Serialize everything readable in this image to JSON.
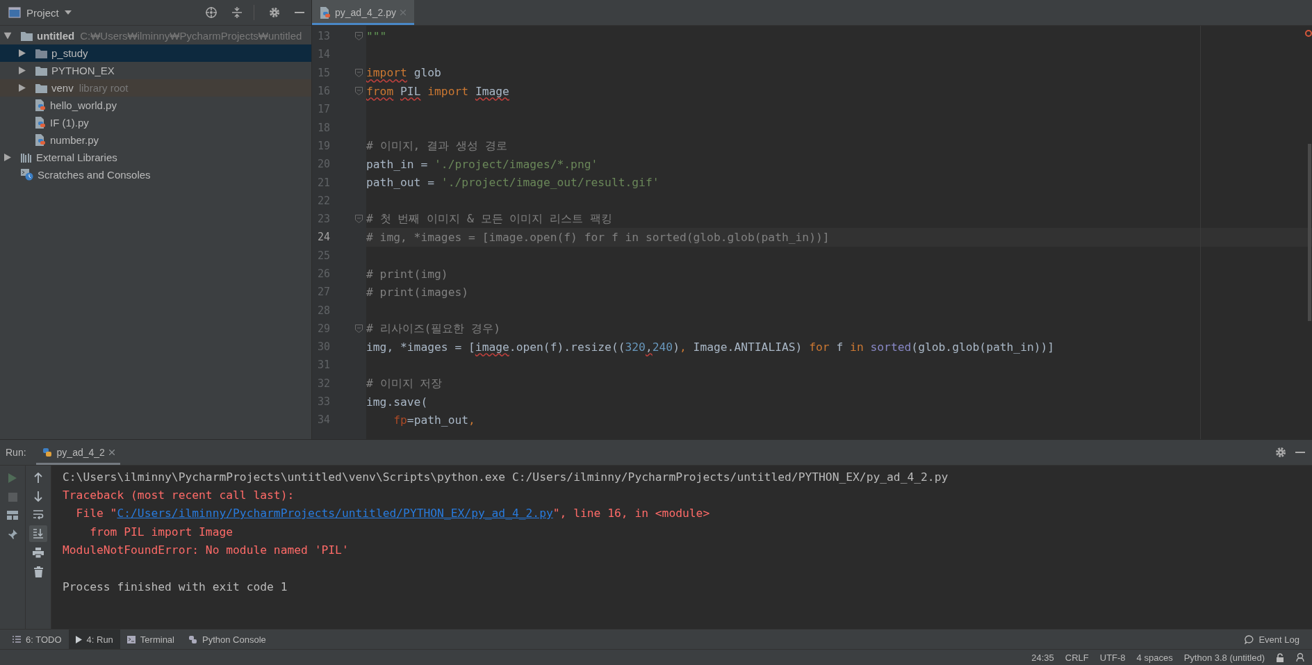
{
  "project_panel": {
    "title": "Project",
    "tree": [
      {
        "label": "untitled",
        "hint": "C:₩Users₩ilminny₩PycharmProjects₩untitled",
        "kind": "project-folder",
        "expanded": true,
        "selected": false,
        "children": [
          {
            "label": "p_study",
            "kind": "folder",
            "expanded": false,
            "selected": true
          },
          {
            "label": "PYTHON_EX",
            "kind": "folder",
            "expanded": false,
            "selected": false
          },
          {
            "label": "venv",
            "hint": "library root",
            "kind": "library-folder",
            "expanded": false,
            "selected": false
          },
          {
            "label": "hello_world.py",
            "kind": "python-file",
            "selected": false
          },
          {
            "label": "IF (1).py",
            "kind": "python-file",
            "selected": false
          },
          {
            "label": "number.py",
            "kind": "python-file",
            "selected": false
          }
        ]
      },
      {
        "label": "External Libraries",
        "kind": "libraries",
        "expanded": false,
        "selected": false
      },
      {
        "label": "Scratches and Consoles",
        "kind": "scratches",
        "selected": false
      }
    ]
  },
  "editor": {
    "tabs": [
      {
        "label": "py_ad_4_2.py",
        "selected": true
      }
    ],
    "lines": [
      {
        "n": "13",
        "fold": true,
        "current": false,
        "tokens": [
          {
            "text": "\"\"\"",
            "kind": "docstring"
          }
        ]
      },
      {
        "n": "14",
        "fold": false,
        "current": false
      },
      {
        "n": "15",
        "fold": true,
        "current": false,
        "tokens": [
          {
            "text": "import",
            "kind": "kw-warn"
          },
          {
            "text": " glob",
            "kind": "plain"
          }
        ]
      },
      {
        "n": "16",
        "fold": true,
        "current": false,
        "tokens": [
          {
            "text": "from ",
            "kind": "kw-warn"
          },
          {
            "text": "PIL ",
            "kind": "plain-warn"
          },
          {
            "text": "import ",
            "kind": "kw"
          },
          {
            "text": "Image",
            "kind": "plain-warn"
          }
        ]
      },
      {
        "n": "17",
        "fold": false,
        "current": false
      },
      {
        "n": "18",
        "fold": false,
        "current": false
      },
      {
        "n": "19",
        "fold": false,
        "current": false,
        "tokens": [
          {
            "text": "# 이미지, 결과 생성 경로",
            "kind": "comment"
          }
        ]
      },
      {
        "n": "20",
        "fold": false,
        "current": false,
        "tokens": [
          {
            "text": "path_in = ",
            "kind": "plain"
          },
          {
            "text": "'./project/images/*.png'",
            "kind": "string"
          }
        ]
      },
      {
        "n": "21",
        "fold": false,
        "current": false,
        "tokens": [
          {
            "text": "path_out = ",
            "kind": "plain"
          },
          {
            "text": "'./project/image_out/result.gif'",
            "kind": "string"
          }
        ]
      },
      {
        "n": "22",
        "fold": false,
        "current": false
      },
      {
        "n": "23",
        "fold": true,
        "current": false,
        "tokens": [
          {
            "text": "# 첫 번째 이미지 & 모든 이미지 리스트 팩킹",
            "kind": "comment"
          }
        ]
      },
      {
        "n": "24",
        "fold": false,
        "current": true,
        "tokens": [
          {
            "text": "# img, *images = [image.open(f) for f in sorted(glob.glob(path_in))]",
            "kind": "comment"
          }
        ]
      },
      {
        "n": "25",
        "fold": false,
        "current": false
      },
      {
        "n": "26",
        "fold": false,
        "current": false,
        "tokens": [
          {
            "text": "# print(img)",
            "kind": "comment"
          }
        ]
      },
      {
        "n": "27",
        "fold": false,
        "current": false,
        "tokens": [
          {
            "text": "# print(images)",
            "kind": "comment"
          }
        ]
      },
      {
        "n": "28",
        "fold": false,
        "current": false
      },
      {
        "n": "29",
        "fold": true,
        "current": false,
        "tokens": [
          {
            "text": "# 리사이즈(필요한 경우)",
            "kind": "comment"
          }
        ]
      },
      {
        "n": "30",
        "fold": false,
        "current": false,
        "tokens": [
          {
            "text": "img, *images = [",
            "kind": "plain"
          },
          {
            "text": "image",
            "kind": "plain-warn"
          },
          {
            "text": ".open(f).resize((",
            "kind": "plain"
          },
          {
            "text": "320",
            "kind": "number"
          },
          {
            "text": ",",
            "kind": "plain-warn"
          },
          {
            "text": "240",
            "kind": "number"
          },
          {
            "text": ")",
            "kind": "plain"
          },
          {
            "text": ",",
            "kind": "kw"
          },
          {
            "text": " Image.ANTIALIAS) ",
            "kind": "plain"
          },
          {
            "text": "for",
            "kind": "kw"
          },
          {
            "text": " f ",
            "kind": "plain"
          },
          {
            "text": "in ",
            "kind": "kw"
          },
          {
            "text": "sorted",
            "kind": "builtin"
          },
          {
            "text": "(glob.glob(path_in))]",
            "kind": "plain"
          }
        ]
      },
      {
        "n": "31",
        "fold": false,
        "current": false
      },
      {
        "n": "32",
        "fold": false,
        "current": false,
        "tokens": [
          {
            "text": "# 이미지 저장",
            "kind": "comment"
          }
        ]
      },
      {
        "n": "33",
        "fold": false,
        "current": false,
        "tokens": [
          {
            "text": "img.save(",
            "kind": "plain"
          }
        ]
      },
      {
        "n": "34",
        "fold": false,
        "current": false,
        "tokens": [
          {
            "text": "    fp",
            "kind": "param"
          },
          {
            "text": "=path_out",
            "kind": "plain"
          },
          {
            "text": ",",
            "kind": "kw"
          }
        ]
      }
    ]
  },
  "run_panel": {
    "label": "Run:",
    "tabs": [
      {
        "label": "py_ad_4_2",
        "selected": true
      }
    ],
    "output": [
      {
        "kind": "output",
        "parts": [
          {
            "text": "C:\\Users\\ilminny\\PycharmProjects\\untitled\\venv\\Scripts\\python.exe C:/Users/ilminny/PycharmProjects/untitled/PYTHON_EX/py_ad_4_2.py",
            "kind": "plain"
          }
        ]
      },
      {
        "kind": "output",
        "parts": [
          {
            "text": "Traceback (most recent call last):",
            "kind": "error"
          }
        ]
      },
      {
        "kind": "output",
        "parts": [
          {
            "text": "  File \"",
            "kind": "error"
          },
          {
            "text": "C:/Users/ilminny/PycharmProjects/untitled/PYTHON_EX/py_ad_4_2.py",
            "kind": "link"
          },
          {
            "text": "\", line 16, in <module>",
            "kind": "error"
          }
        ]
      },
      {
        "kind": "output",
        "parts": [
          {
            "text": "    from PIL import Image",
            "kind": "error"
          }
        ]
      },
      {
        "kind": "output",
        "parts": [
          {
            "text": "ModuleNotFoundError: No module named 'PIL'",
            "kind": "error"
          }
        ]
      },
      {
        "kind": "exit",
        "parts": [
          {
            "text": "Process finished with exit code 1",
            "kind": "plain"
          }
        ]
      }
    ]
  },
  "tool_windows": [
    {
      "label": "6: TODO",
      "kind": "list",
      "selected": false
    },
    {
      "label": "4: Run",
      "kind": "run",
      "selected": true
    },
    {
      "label": "Terminal",
      "kind": "terminal",
      "selected": false
    },
    {
      "label": "Python Console",
      "kind": "python",
      "selected": false
    }
  ],
  "event_log": "Event Log",
  "status_bar": {
    "items": [
      "24:35",
      "CRLF",
      "UTF-8",
      "4 spaces",
      "Python 3.8 (untitled)"
    ]
  }
}
